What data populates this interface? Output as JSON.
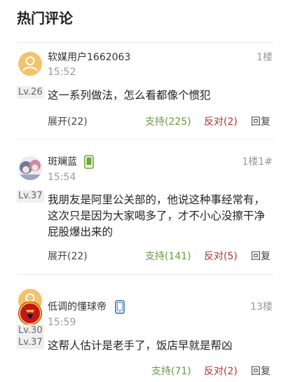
{
  "section": {
    "title": "热门评论"
  },
  "colors": {
    "support": "#6a9a3f",
    "oppose": "#b6332e",
    "avatar_default": "#f3c36b",
    "phone_icon_green": "#6aaa35",
    "phone_icon_blue": "#2f6fb5"
  },
  "comments": [
    {
      "username": "软媒用户1662063",
      "device_icon": "",
      "floor": "1楼",
      "time": "15:52",
      "level": "Lv.26",
      "text": "这一系列做法，怎么看都像个惯犯",
      "expand": "展开(22)",
      "support": "支持(225)",
      "oppose": "反对(2)",
      "reply": "回复"
    },
    {
      "username": "斑斓蓝",
      "device_icon": "android-phone-icon",
      "floor": "1楼1#",
      "time": "15:54",
      "level": "Lv.37",
      "text": "我朋友是阿里公关部的，他说这种事经常有，这次只是因为大家喝多了，才不小心没擦干净屁股爆出来的",
      "expand": "展开(22)",
      "support": "支持(141)",
      "oppose": "反对(5)",
      "reply": "回复"
    },
    {
      "username": "低调的懂球帝",
      "device_icon": "ios-phone-icon",
      "floor": "13楼",
      "time": "15:59",
      "level_top": "Lv.30",
      "level": "Lv.37",
      "text": "这帮人估计是老手了，饭店早就是帮凶",
      "support": "支持(71)",
      "oppose": "反对(2)",
      "reply": "回复"
    }
  ]
}
